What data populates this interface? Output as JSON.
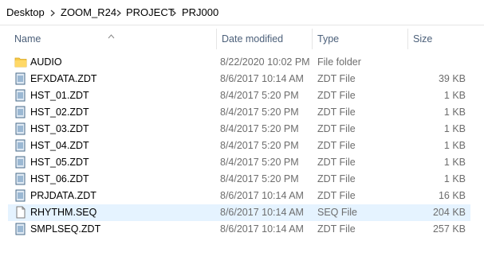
{
  "breadcrumb": [
    "Desktop",
    "ZOOM_R24",
    "PROJECT",
    "PRJ000"
  ],
  "columns": {
    "name": "Name",
    "date": "Date modified",
    "type": "Type",
    "size": "Size"
  },
  "sort": {
    "column": "Name",
    "direction": "ascending"
  },
  "files": [
    {
      "name": "AUDIO",
      "date": "8/22/2020 10:02 PM",
      "type": "File folder",
      "size": "",
      "icon": "folder-icon"
    },
    {
      "name": "EFXDATA.ZDT",
      "date": "8/6/2017 10:14 AM",
      "type": "ZDT File",
      "size": "39 KB",
      "icon": "zdt-file-icon"
    },
    {
      "name": "HST_01.ZDT",
      "date": "8/4/2017 5:20 PM",
      "type": "ZDT File",
      "size": "1 KB",
      "icon": "zdt-file-icon"
    },
    {
      "name": "HST_02.ZDT",
      "date": "8/4/2017 5:20 PM",
      "type": "ZDT File",
      "size": "1 KB",
      "icon": "zdt-file-icon"
    },
    {
      "name": "HST_03.ZDT",
      "date": "8/4/2017 5:20 PM",
      "type": "ZDT File",
      "size": "1 KB",
      "icon": "zdt-file-icon"
    },
    {
      "name": "HST_04.ZDT",
      "date": "8/4/2017 5:20 PM",
      "type": "ZDT File",
      "size": "1 KB",
      "icon": "zdt-file-icon"
    },
    {
      "name": "HST_05.ZDT",
      "date": "8/4/2017 5:20 PM",
      "type": "ZDT File",
      "size": "1 KB",
      "icon": "zdt-file-icon"
    },
    {
      "name": "HST_06.ZDT",
      "date": "8/4/2017 5:20 PM",
      "type": "ZDT File",
      "size": "1 KB",
      "icon": "zdt-file-icon"
    },
    {
      "name": "PRJDATA.ZDT",
      "date": "8/6/2017 10:14 AM",
      "type": "ZDT File",
      "size": "16 KB",
      "icon": "zdt-file-icon"
    },
    {
      "name": "RHYTHM.SEQ",
      "date": "8/6/2017 10:14 AM",
      "type": "SEQ File",
      "size": "204 KB",
      "icon": "blank-file-icon",
      "selected": true
    },
    {
      "name": "SMPLSEQ.ZDT",
      "date": "8/6/2017 10:14 AM",
      "type": "ZDT File",
      "size": "257 KB",
      "icon": "zdt-file-icon"
    }
  ],
  "colors": {
    "header_text": "#4c607a",
    "row_meta_text": "#6d6d6d",
    "selected_row": "#e5f3ff",
    "folder": "#f6c94a"
  }
}
